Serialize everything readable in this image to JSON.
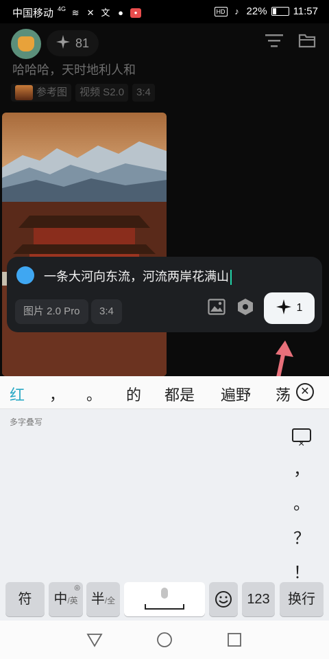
{
  "status_bar": {
    "carrier": "中国移动",
    "network": "4G",
    "battery": "22%",
    "time": "11:57"
  },
  "header": {
    "credits": "81",
    "prompt_title": "哈哈哈，天时地利人和",
    "tags": [
      "参考图",
      "视频 S2.0",
      "3:4"
    ]
  },
  "input": {
    "text": "一条大河向东流，河流两岸花满山",
    "model_chip": "图片 2.0 Pro",
    "ratio_chip": "3:4",
    "generate_count": "1"
  },
  "keyboard": {
    "candidates": [
      "红",
      "，",
      "。",
      "的",
      "都是",
      "遍野",
      "荡"
    ],
    "handwriting_label": "多字叠写",
    "side_keys": [
      "，",
      "。",
      "？",
      "！"
    ],
    "bottom_keys": {
      "symbols": "符",
      "zh": "中",
      "zh_sub": "/英",
      "half": "半",
      "half_sub": "/全",
      "num": "123",
      "enter": "换行"
    }
  },
  "colors": {
    "accent_blue": "#3fa7f2",
    "caret": "#22d3a8",
    "annotation_arrow": "#e8707a",
    "candidate_highlight": "#2aa9c5"
  },
  "icons": {
    "credits": "sparkle-icon",
    "filter": "filter-icon",
    "folder": "folder-icon",
    "image_upload": "image-icon",
    "settings": "hexagon-settings-icon",
    "generate": "sparkle-icon"
  }
}
